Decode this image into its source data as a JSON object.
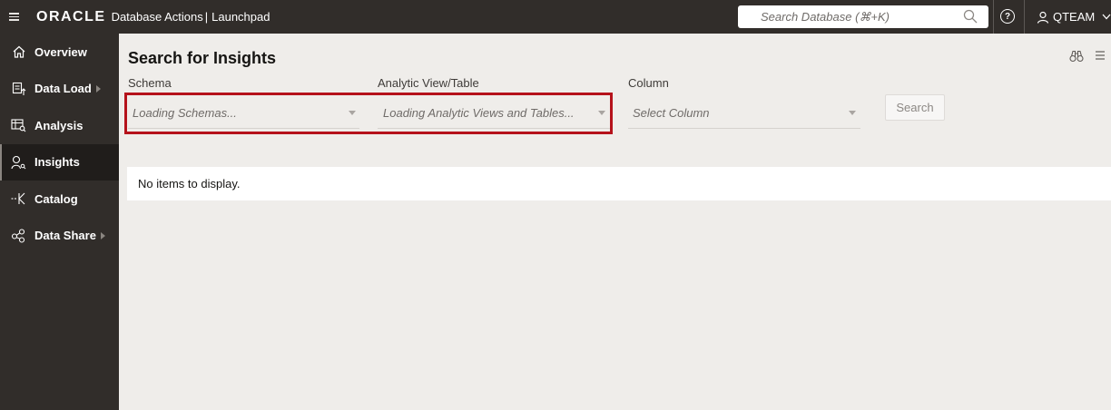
{
  "header": {
    "brand": "ORACLE",
    "app_name": "Database Actions",
    "separator": "|",
    "section": "Launchpad",
    "search_placeholder": "Search Database (⌘+K)",
    "help_symbol": "?",
    "user_name": "QTEAM"
  },
  "sidebar": {
    "items": [
      {
        "label": "Overview",
        "icon": "home-icon"
      },
      {
        "label": "Data Load",
        "icon": "data-load-icon",
        "has_submenu": true
      },
      {
        "label": "Analysis",
        "icon": "analysis-icon"
      },
      {
        "label": "Insights",
        "icon": "insights-icon",
        "active": true
      },
      {
        "label": "Catalog",
        "icon": "catalog-icon"
      },
      {
        "label": "Data Share",
        "icon": "data-share-icon",
        "has_submenu": true
      }
    ]
  },
  "main": {
    "title": "Search for Insights",
    "fields": {
      "schema_label": "Schema",
      "schema_value": "Loading Schemas...",
      "analytic_label": "Analytic View/Table",
      "analytic_value": "Loading Analytic Views and Tables...",
      "column_label": "Column",
      "column_value": "Select Column"
    },
    "search_button": "Search",
    "empty_message": "No items to display."
  },
  "colors": {
    "topbar_bg": "#312d2a",
    "highlight_border": "#b5121b",
    "page_bg": "#efedea"
  }
}
